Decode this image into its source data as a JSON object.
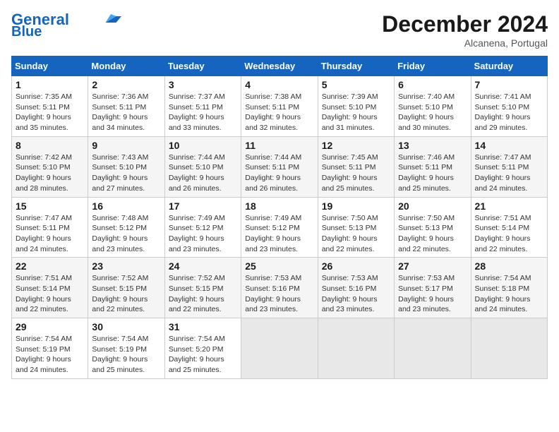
{
  "header": {
    "logo_line1": "General",
    "logo_line2": "Blue",
    "month_title": "December 2024",
    "location": "Alcanena, Portugal"
  },
  "weekdays": [
    "Sunday",
    "Monday",
    "Tuesday",
    "Wednesday",
    "Thursday",
    "Friday",
    "Saturday"
  ],
  "weeks": [
    [
      {
        "day": "1",
        "info": "Sunrise: 7:35 AM\nSunset: 5:11 PM\nDaylight: 9 hours and 35 minutes."
      },
      {
        "day": "2",
        "info": "Sunrise: 7:36 AM\nSunset: 5:11 PM\nDaylight: 9 hours and 34 minutes."
      },
      {
        "day": "3",
        "info": "Sunrise: 7:37 AM\nSunset: 5:11 PM\nDaylight: 9 hours and 33 minutes."
      },
      {
        "day": "4",
        "info": "Sunrise: 7:38 AM\nSunset: 5:11 PM\nDaylight: 9 hours and 32 minutes."
      },
      {
        "day": "5",
        "info": "Sunrise: 7:39 AM\nSunset: 5:10 PM\nDaylight: 9 hours and 31 minutes."
      },
      {
        "day": "6",
        "info": "Sunrise: 7:40 AM\nSunset: 5:10 PM\nDaylight: 9 hours and 30 minutes."
      },
      {
        "day": "7",
        "info": "Sunrise: 7:41 AM\nSunset: 5:10 PM\nDaylight: 9 hours and 29 minutes."
      }
    ],
    [
      {
        "day": "8",
        "info": "Sunrise: 7:42 AM\nSunset: 5:10 PM\nDaylight: 9 hours and 28 minutes."
      },
      {
        "day": "9",
        "info": "Sunrise: 7:43 AM\nSunset: 5:10 PM\nDaylight: 9 hours and 27 minutes."
      },
      {
        "day": "10",
        "info": "Sunrise: 7:44 AM\nSunset: 5:10 PM\nDaylight: 9 hours and 26 minutes."
      },
      {
        "day": "11",
        "info": "Sunrise: 7:44 AM\nSunset: 5:11 PM\nDaylight: 9 hours and 26 minutes."
      },
      {
        "day": "12",
        "info": "Sunrise: 7:45 AM\nSunset: 5:11 PM\nDaylight: 9 hours and 25 minutes."
      },
      {
        "day": "13",
        "info": "Sunrise: 7:46 AM\nSunset: 5:11 PM\nDaylight: 9 hours and 25 minutes."
      },
      {
        "day": "14",
        "info": "Sunrise: 7:47 AM\nSunset: 5:11 PM\nDaylight: 9 hours and 24 minutes."
      }
    ],
    [
      {
        "day": "15",
        "info": "Sunrise: 7:47 AM\nSunset: 5:11 PM\nDaylight: 9 hours and 24 minutes."
      },
      {
        "day": "16",
        "info": "Sunrise: 7:48 AM\nSunset: 5:12 PM\nDaylight: 9 hours and 23 minutes."
      },
      {
        "day": "17",
        "info": "Sunrise: 7:49 AM\nSunset: 5:12 PM\nDaylight: 9 hours and 23 minutes."
      },
      {
        "day": "18",
        "info": "Sunrise: 7:49 AM\nSunset: 5:12 PM\nDaylight: 9 hours and 23 minutes."
      },
      {
        "day": "19",
        "info": "Sunrise: 7:50 AM\nSunset: 5:13 PM\nDaylight: 9 hours and 22 minutes."
      },
      {
        "day": "20",
        "info": "Sunrise: 7:50 AM\nSunset: 5:13 PM\nDaylight: 9 hours and 22 minutes."
      },
      {
        "day": "21",
        "info": "Sunrise: 7:51 AM\nSunset: 5:14 PM\nDaylight: 9 hours and 22 minutes."
      }
    ],
    [
      {
        "day": "22",
        "info": "Sunrise: 7:51 AM\nSunset: 5:14 PM\nDaylight: 9 hours and 22 minutes."
      },
      {
        "day": "23",
        "info": "Sunrise: 7:52 AM\nSunset: 5:15 PM\nDaylight: 9 hours and 22 minutes."
      },
      {
        "day": "24",
        "info": "Sunrise: 7:52 AM\nSunset: 5:15 PM\nDaylight: 9 hours and 22 minutes."
      },
      {
        "day": "25",
        "info": "Sunrise: 7:53 AM\nSunset: 5:16 PM\nDaylight: 9 hours and 23 minutes."
      },
      {
        "day": "26",
        "info": "Sunrise: 7:53 AM\nSunset: 5:16 PM\nDaylight: 9 hours and 23 minutes."
      },
      {
        "day": "27",
        "info": "Sunrise: 7:53 AM\nSunset: 5:17 PM\nDaylight: 9 hours and 23 minutes."
      },
      {
        "day": "28",
        "info": "Sunrise: 7:54 AM\nSunset: 5:18 PM\nDaylight: 9 hours and 24 minutes."
      }
    ],
    [
      {
        "day": "29",
        "info": "Sunrise: 7:54 AM\nSunset: 5:19 PM\nDaylight: 9 hours and 24 minutes."
      },
      {
        "day": "30",
        "info": "Sunrise: 7:54 AM\nSunset: 5:19 PM\nDaylight: 9 hours and 25 minutes."
      },
      {
        "day": "31",
        "info": "Sunrise: 7:54 AM\nSunset: 5:20 PM\nDaylight: 9 hours and 25 minutes."
      },
      {
        "day": "",
        "info": ""
      },
      {
        "day": "",
        "info": ""
      },
      {
        "day": "",
        "info": ""
      },
      {
        "day": "",
        "info": ""
      }
    ]
  ]
}
